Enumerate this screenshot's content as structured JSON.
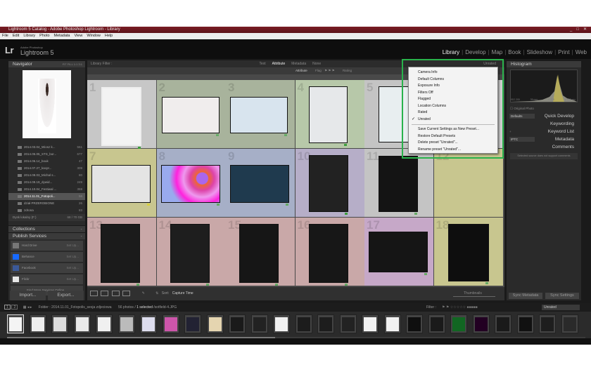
{
  "window": {
    "title": "Lightroom 5 Catalog - Adobe Photoshop Lightroom - Library",
    "controls": [
      "_",
      "□",
      "✕"
    ]
  },
  "menu": [
    "File",
    "Edit",
    "Library",
    "Photo",
    "Metadata",
    "View",
    "Window",
    "Help"
  ],
  "identity": {
    "logo": "Lr",
    "brand_small": "Adobe Photoshop",
    "brand": "Lightroom 5"
  },
  "modules": [
    "Library",
    "Develop",
    "Map",
    "Book",
    "Slideshow",
    "Print",
    "Web"
  ],
  "left": {
    "navigator": {
      "title": "Navigator",
      "options": "FIT  FILL  1:1  3:1"
    },
    "folders": [
      {
        "name": "2014.03.04_Wiosz k...",
        "count": "561"
      },
      {
        "name": "2014.05.05_STS_bor...",
        "count": "677"
      },
      {
        "name": "2014.06.14_bouk",
        "count": "47"
      },
      {
        "name": "2014.07.27_kacpr...",
        "count": "309"
      },
      {
        "name": "2014.08.03_Michal s...",
        "count": "80"
      },
      {
        "name": "2014.09.19_dywid...",
        "count": "249"
      },
      {
        "name": "2014.10.04_Festiwal ...",
        "count": "359"
      },
      {
        "name": "2014.11.01_Fotopoli...",
        "count": "56"
      },
      {
        "name": "dział PRZEROBIONE",
        "count": "26"
      },
      {
        "name": "zdrona",
        "count": "83"
      }
    ],
    "disk": {
      "name": "Dysk lokalny (F:)",
      "size": "68 / 70 GB"
    },
    "collections": "Collections",
    "publish": "Publish Services",
    "services": [
      {
        "name": "Hard Drive",
        "setup": "Set Up..."
      },
      {
        "name": "Behance",
        "setup": "Set Up..."
      },
      {
        "name": "Facebook",
        "setup": "Set Up..."
      },
      {
        "name": "Flickr",
        "setup": "Set Up..."
      }
    ],
    "find_more": "Find More Services Online...",
    "import": "Import...",
    "export": "Export..."
  },
  "filter": {
    "title": "Library Filter :",
    "tabs": [
      "Text",
      "Attribute",
      "Metadata",
      "None"
    ],
    "active": "Attribute",
    "unrated": "Unrated",
    "attribute_label": "Attribute",
    "flag_label": "Flag",
    "rating_label": "Rating"
  },
  "grid": {
    "numbers": [
      "1",
      "2",
      "3",
      "4",
      "5",
      "6",
      "7",
      "8",
      "9",
      "10",
      "11",
      "12",
      "13",
      "14",
      "15",
      "16",
      "17",
      "18"
    ]
  },
  "toolbar": {
    "sort_label": "Sort:",
    "sort_value": "Capture Time",
    "thumbnails": "Thumbnails"
  },
  "popup": {
    "items": [
      "Camera Info",
      "Default Columns",
      "Exposure Info",
      "Filters Off",
      "Flagged",
      "Location Columns",
      "Rated",
      "Unrated"
    ],
    "checked": "Unrated",
    "actions": [
      "Save Current Settings as New Preset...",
      "Restore Default Presets",
      "Delete preset \"Unrated\"...",
      "Rename preset \"Unrated\"..."
    ]
  },
  "right": {
    "histogram": "Histogram",
    "histo_info": [
      "ISO 200",
      "35 mm",
      "f / 2.8",
      "1/125 sec"
    ],
    "original_photo": "Original Photo",
    "defaults": "Defaults",
    "quick_develop": "Quick Develop",
    "keywording": "Keywording",
    "keyword_list": "Keyword List",
    "metadata_preset": "IPTC",
    "metadata": "Metadata",
    "comments": "Comments",
    "comments_note": "Selected source does not support comments",
    "sync_metadata": "Sync Metadata",
    "sync_settings": "Sync Settings"
  },
  "filmstrip": {
    "pages": [
      "1",
      "2"
    ],
    "path": "Folder : 2014.11.01_Fotopolis_sesja zdjeciowa",
    "count": "56 photos /",
    "selected": "1 selected",
    "file": "/sotfield-4.JPG",
    "filter_label": "Filter :",
    "filter_value": "Unrated"
  },
  "colors": {
    "accent_green": "#29b24b",
    "titlebar": "#7a1d25",
    "popup_bg": "#f3f3f3"
  }
}
